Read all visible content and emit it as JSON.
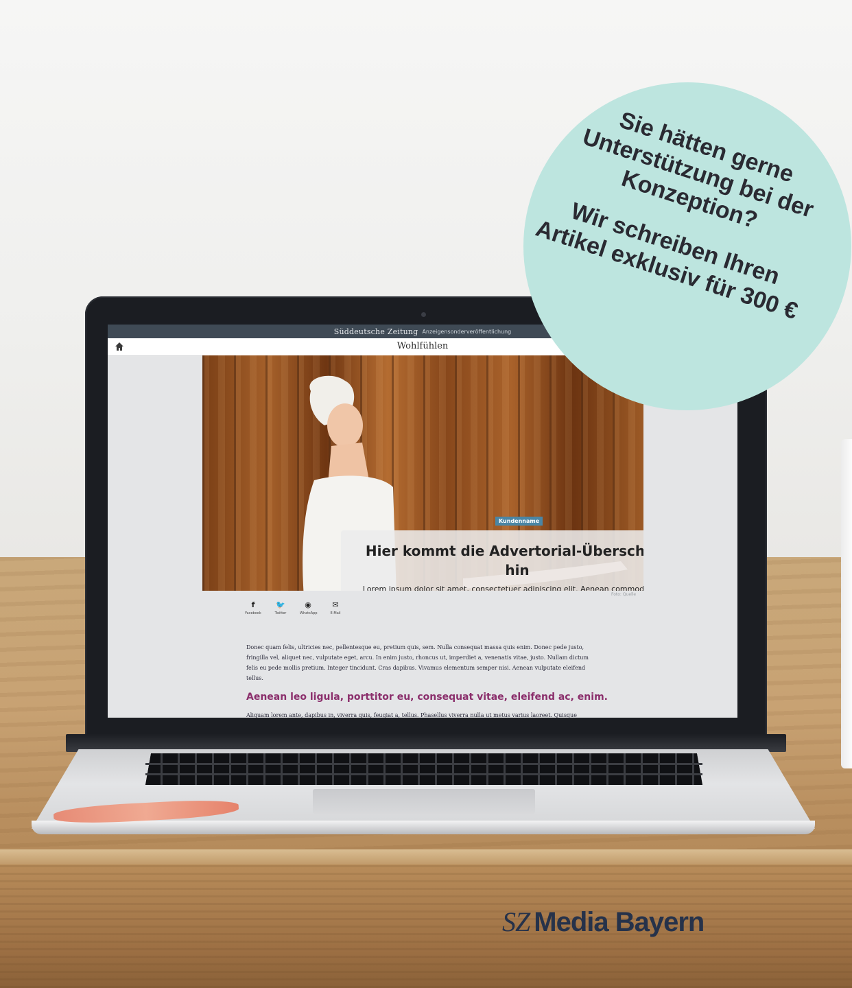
{
  "screen": {
    "publisher": "Süddeutsche Zeitung",
    "publisher_note": "Anzeigensonderveröffentlichung",
    "section_title": "Wohlfühlen",
    "hero": {
      "badge": "Kundenname",
      "headline": "Hier kommt die Advertorial-Überschrift hin",
      "lead": "Lorem ipsum dolor sit amet, consectetuer adipiscing elit. Aenean commodo ligula eget dolor. Aenean massa.",
      "photo_credit": "Foto: Quelle"
    },
    "share": [
      {
        "icon": "facebook-icon",
        "glyph": "f",
        "label": "Facebook"
      },
      {
        "icon": "twitter-icon",
        "glyph": "🐦",
        "label": "Twitter"
      },
      {
        "icon": "whatsapp-icon",
        "glyph": "◉",
        "label": "WhatsApp"
      },
      {
        "icon": "email-icon",
        "glyph": "✉",
        "label": "E-Mail"
      }
    ],
    "body_paragraph": "Donec quam felis, ultricies nec, pellentesque eu, pretium quis, sem. Nulla consequat massa quis enim. Donec pede justo, fringilla vel, aliquet nec, vulputate eget, arcu. In enim justo, rhoncus ut, imperdiet a, venenatis vitae, justo. Nullam dictum felis eu pede mollis pretium. Integer tincidunt. Cras dapibus. Vivamus elementum semper nisi. Aenean vulputate eleifend tellus.",
    "subheading": "Aenean leo ligula, porttitor eu, consequat vitae, eleifend ac, enim.",
    "body_paragraph_2": "Aliquam lorem ante, dapibus in, viverra quis, feugiat a, tellus. Phasellus viverra nulla ut metus varius laoreet. Quisque"
  },
  "overlay": {
    "question": "Sie hätten gerne Unterstützung bei der Konzeption?",
    "offer": "Wir schreiben Ihren Artikel exklusiv für 300 €",
    "color": "#bde5df"
  },
  "logo": {
    "prefix": "SZ",
    "name": "Media Bayern",
    "color": "#26324a"
  },
  "colors": {
    "subhead": "#8b2f6c",
    "badge": "#4a86a5",
    "topbar": "#3f4a55"
  }
}
